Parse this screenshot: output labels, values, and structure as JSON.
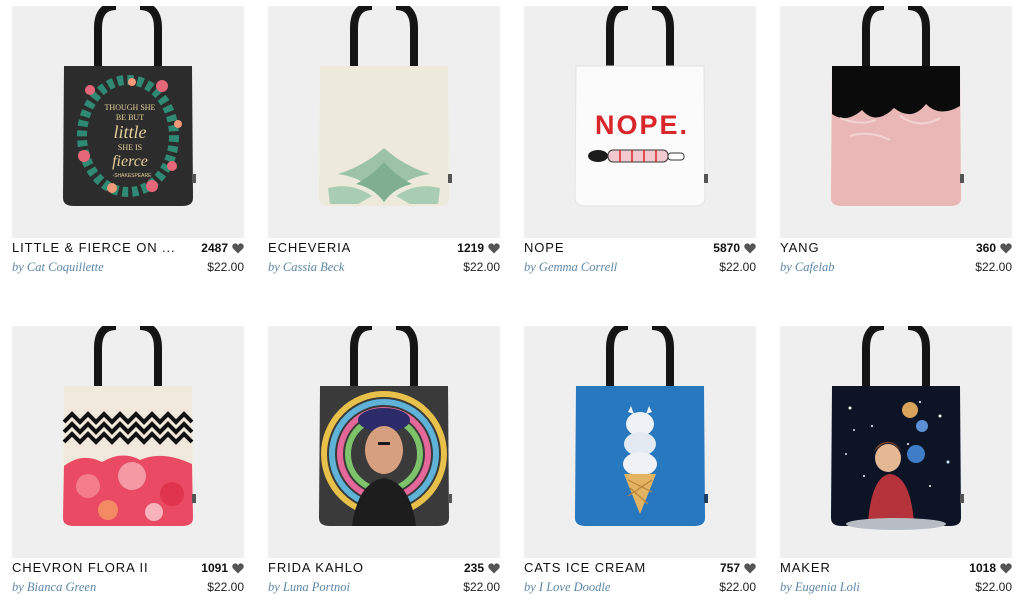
{
  "products": [
    {
      "title": "LITTLE & FIERCE ON ...",
      "artist": "by Cat Coquillette",
      "likes": "2487",
      "price": "$22.00",
      "bag_color": "#2d2c2c",
      "handle_color": "#151515"
    },
    {
      "title": "ECHEVERIA",
      "artist": "by Cassia Beck",
      "likes": "1219",
      "price": "$22.00",
      "bag_color": "#edeadc",
      "handle_color": "#151515"
    },
    {
      "title": "NOPE",
      "artist": "by Gemma Correll",
      "likes": "5870",
      "price": "$22.00",
      "bag_color": "#fbfbfb",
      "handle_color": "#151515"
    },
    {
      "title": "YANG",
      "artist": "by Cafelab",
      "likes": "360",
      "price": "$22.00",
      "bag_color": "#e8b7b6",
      "handle_color": "#151515"
    },
    {
      "title": "CHEVRON FLORA II",
      "artist": "by Bianca Green",
      "likes": "1091",
      "price": "$22.00",
      "bag_color": "#f2e9dd",
      "handle_color": "#151515"
    },
    {
      "title": "FRIDA KAHLO",
      "artist": "by Luna Portnoi",
      "likes": "235",
      "price": "$22.00",
      "bag_color": "#3a3a3a",
      "handle_color": "#151515"
    },
    {
      "title": "CATS ICE CREAM",
      "artist": "by I Love Doodle",
      "likes": "757",
      "price": "$22.00",
      "bag_color": "#2878bf",
      "handle_color": "#151515"
    },
    {
      "title": "MAKER",
      "artist": "by Eugenia Loli",
      "likes": "1018",
      "price": "$22.00",
      "bag_color": "#0c1426",
      "handle_color": "#151515"
    }
  ],
  "art_text": {
    "nope": "NOPE.",
    "fierce_lines": [
      "THOUGH SHE",
      "BE BUT",
      "little",
      "SHE IS",
      "fierce",
      "-SHAKESPEARE"
    ]
  },
  "colors": {
    "thumb_bg": "#efefef",
    "artist_link": "#5b86a8",
    "heart": "#555555",
    "nope_red": "#d9262b"
  }
}
